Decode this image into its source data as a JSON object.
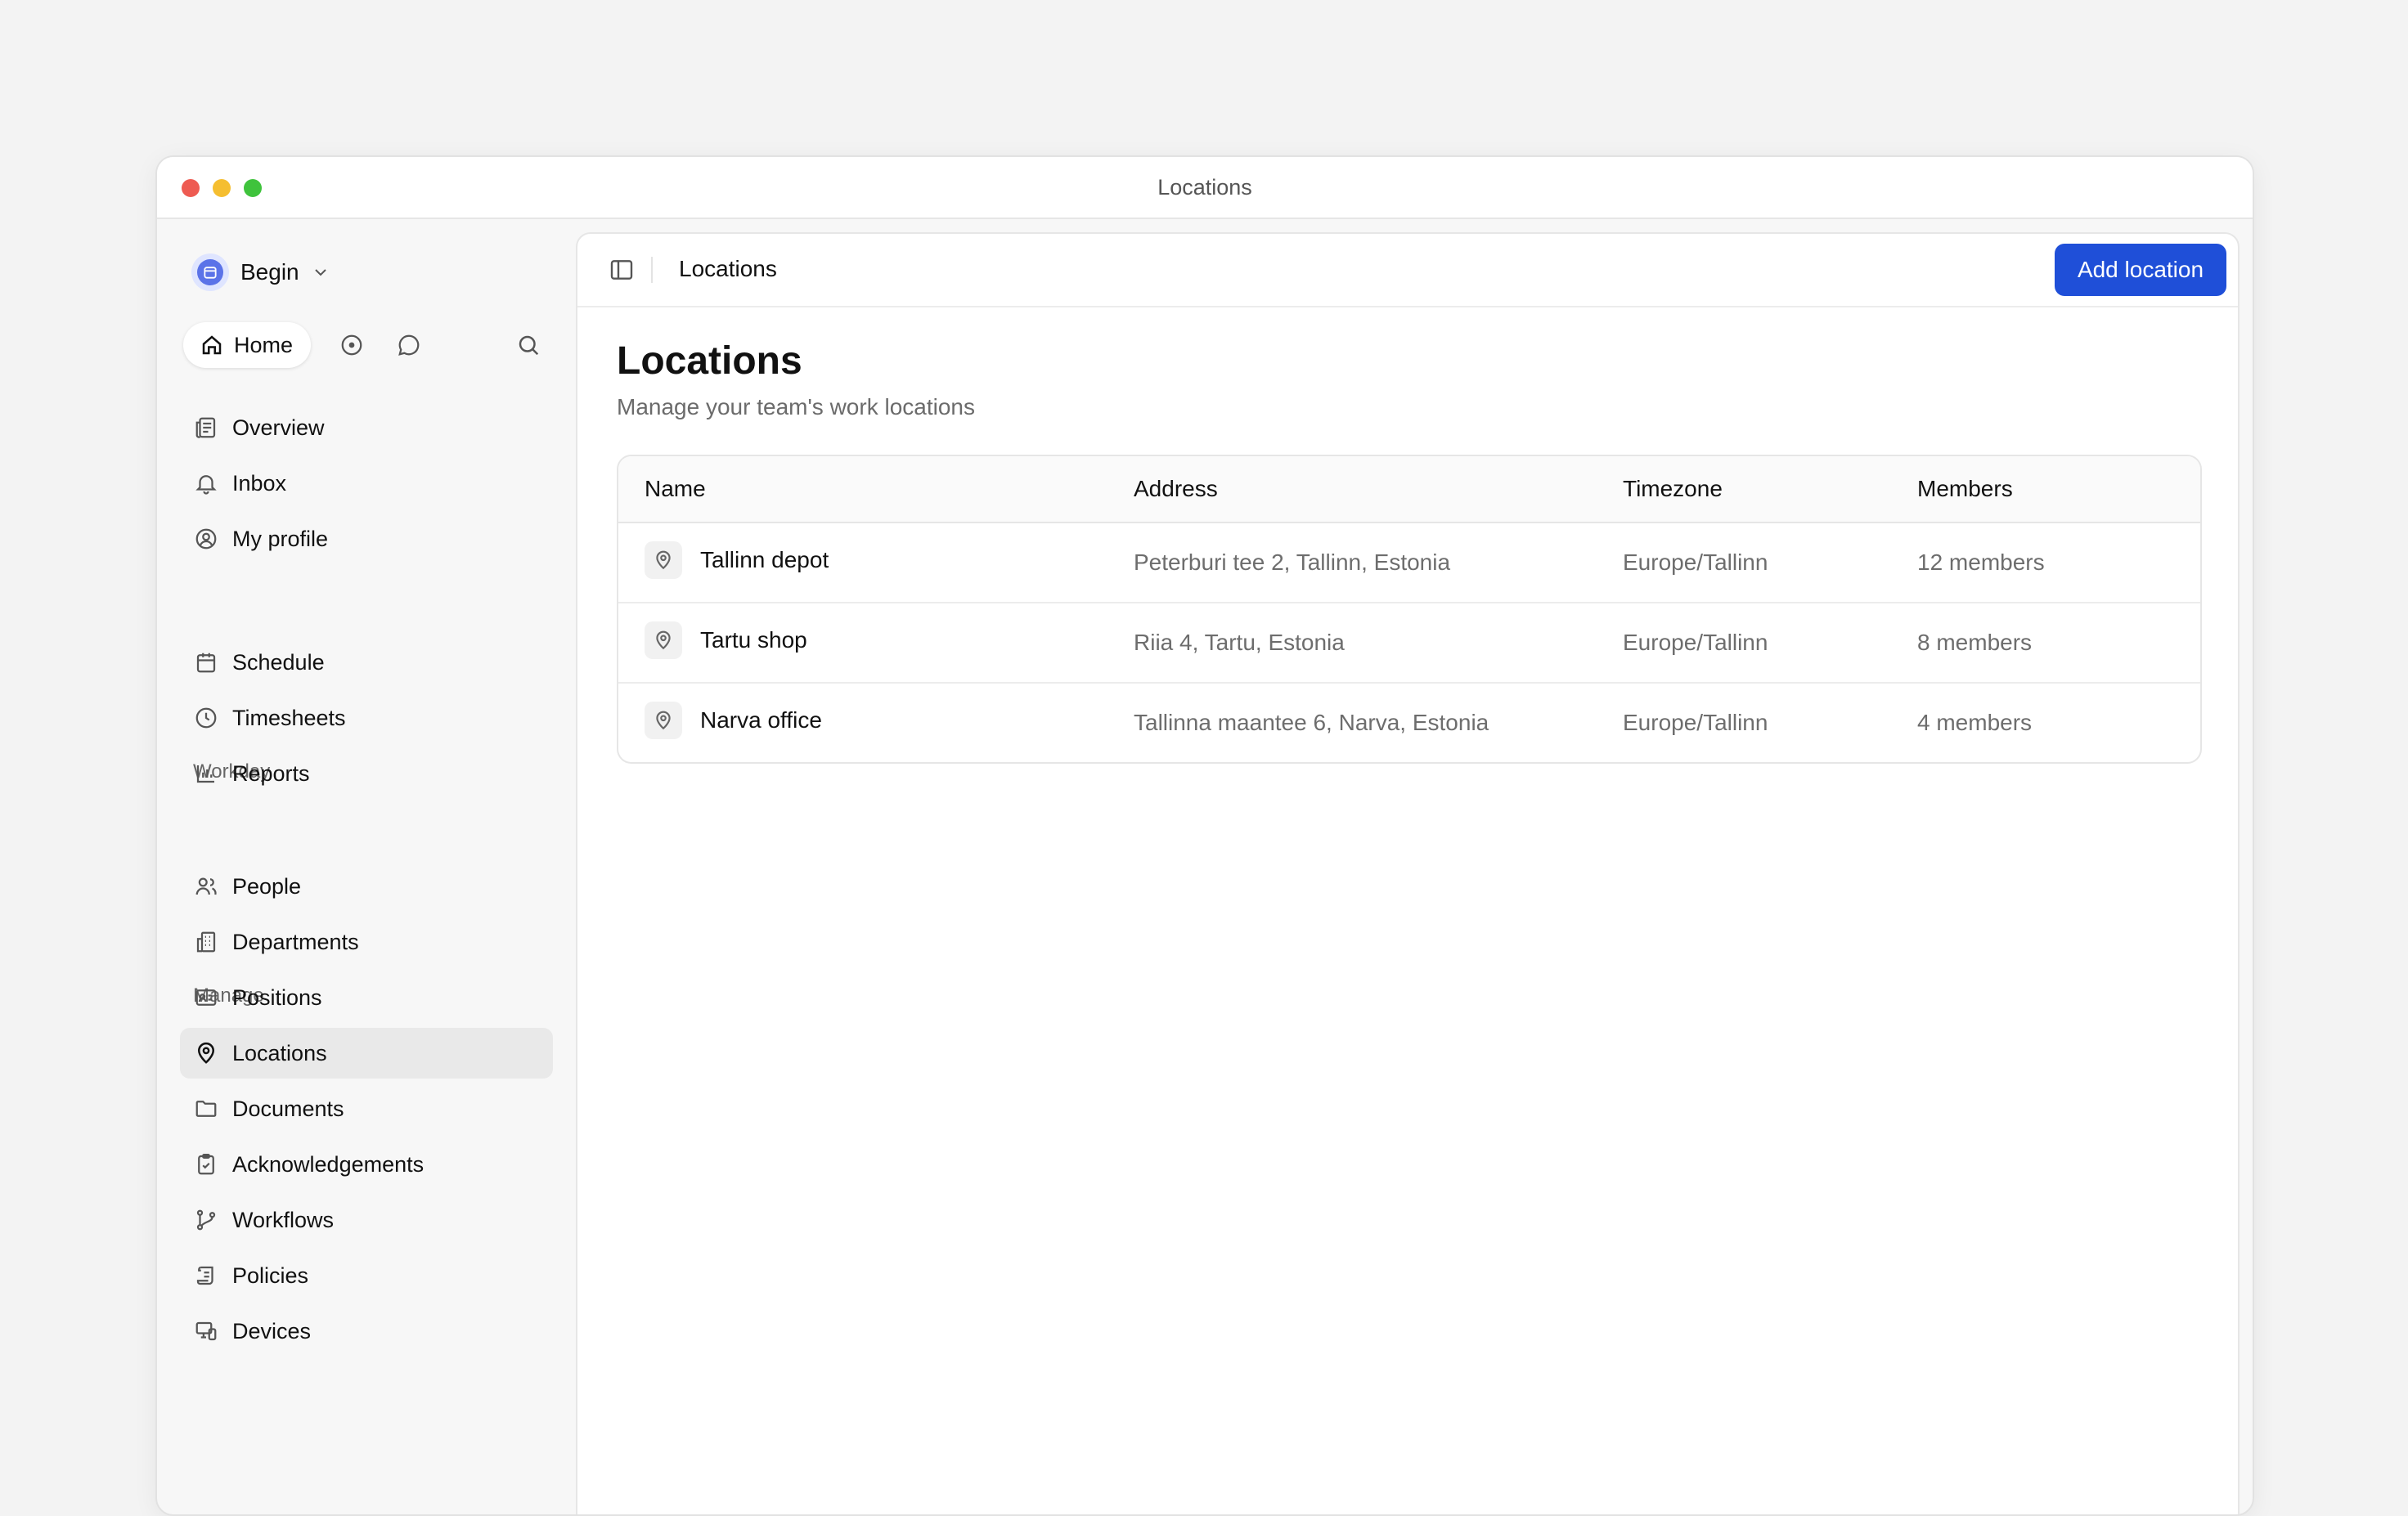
{
  "window": {
    "title": "Locations"
  },
  "sidebar": {
    "workspace": {
      "name": "Begin"
    },
    "quick": {
      "home_label": "Home"
    },
    "items_top": [
      {
        "label": "Overview",
        "icon": "newspaper-icon"
      },
      {
        "label": "Inbox",
        "icon": "bell-icon"
      },
      {
        "label": "My profile",
        "icon": "user-circle-icon"
      }
    ],
    "sections": [
      {
        "label": "Workday",
        "items": [
          {
            "label": "Schedule",
            "icon": "calendar-icon"
          },
          {
            "label": "Timesheets",
            "icon": "clock-icon"
          },
          {
            "label": "Reports",
            "icon": "bar-chart-icon"
          }
        ]
      },
      {
        "label": "Manage",
        "items": [
          {
            "label": "People",
            "icon": "users-icon"
          },
          {
            "label": "Departments",
            "icon": "building-icon"
          },
          {
            "label": "Positions",
            "icon": "id-card-icon"
          },
          {
            "label": "Locations",
            "icon": "map-pin-icon",
            "active": true
          },
          {
            "label": "Documents",
            "icon": "folder-icon"
          },
          {
            "label": "Acknowledgements",
            "icon": "clipboard-check-icon"
          },
          {
            "label": "Workflows",
            "icon": "git-branch-icon"
          },
          {
            "label": "Policies",
            "icon": "scroll-icon"
          },
          {
            "label": "Devices",
            "icon": "devices-icon"
          }
        ]
      }
    ]
  },
  "topbar": {
    "breadcrumb": "Locations",
    "add_button": "Add location",
    "accent": "#1f4fd8"
  },
  "page": {
    "title": "Locations",
    "subtitle": "Manage your team's work locations"
  },
  "table": {
    "columns": [
      "Name",
      "Address",
      "Timezone",
      "Members"
    ],
    "rows": [
      {
        "name": "Tallinn depot",
        "address": "Peterburi tee 2, Tallinn, Estonia",
        "timezone": "Europe/Tallinn",
        "members": "12 members"
      },
      {
        "name": "Tartu shop",
        "address": "Riia 4, Tartu, Estonia",
        "timezone": "Europe/Tallinn",
        "members": "8 members"
      },
      {
        "name": "Narva office",
        "address": "Tallinna maantee 6, Narva, Estonia",
        "timezone": "Europe/Tallinn",
        "members": "4 members"
      }
    ]
  }
}
